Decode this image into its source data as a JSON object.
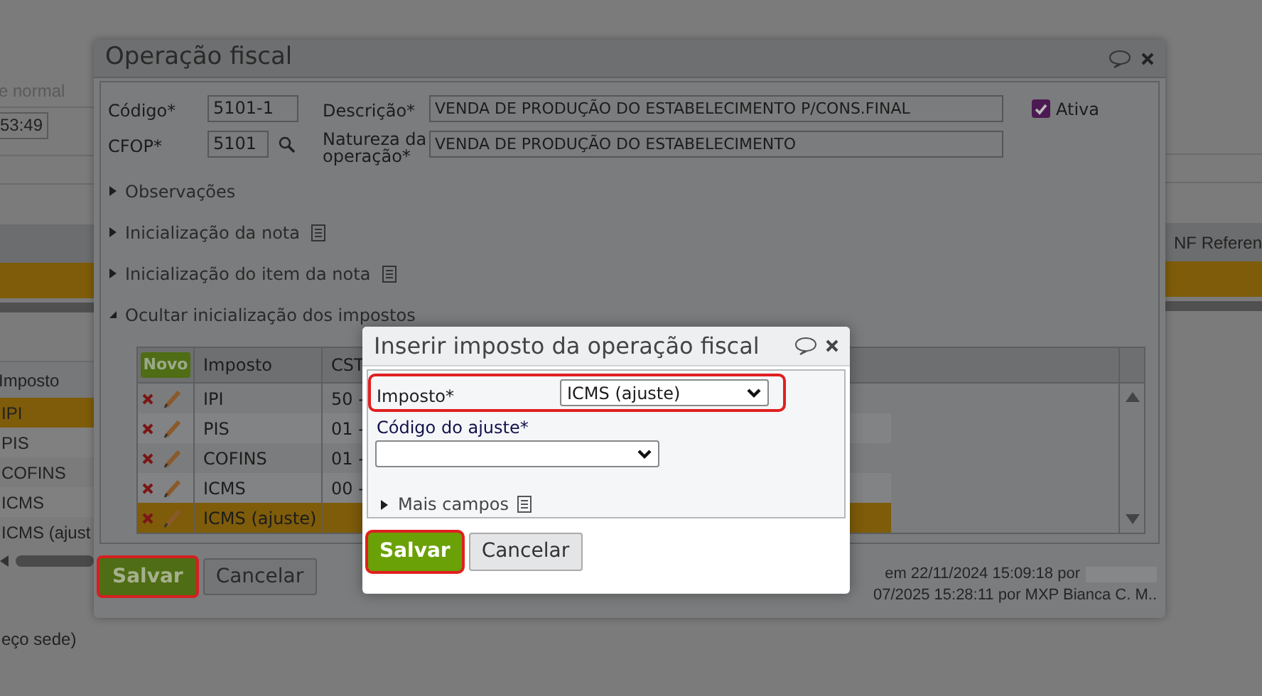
{
  "background": {
    "status_text": "e normal",
    "time_field": "53:49",
    "right_column_header": "NF Referen",
    "left_table": {
      "header": "Imposto",
      "rows": [
        {
          "label": "IPI",
          "selected": true
        },
        {
          "label": "PIS",
          "selected": false
        },
        {
          "label": "COFINS",
          "selected": false
        },
        {
          "label": "ICMS",
          "selected": false
        },
        {
          "label": "ICMS (ajust",
          "selected": false
        }
      ]
    },
    "footer_text": "eço sede)"
  },
  "dialog": {
    "title": "Operação fiscal",
    "codigo_label": "Código*",
    "codigo": "5101-1",
    "cfop_label": "CFOP*",
    "cfop": "5101",
    "descricao_label": "Descrição*",
    "descricao": "VENDA DE PRODUÇÃO DO ESTABELECIMENTO P/CONS.FINAL",
    "natureza_label": "Natureza da operação*",
    "natureza": "VENDA DE PRODUÇÃO DO ESTABELECIMENTO",
    "active_label": "Ativa",
    "active": true,
    "sections": [
      {
        "label": "Observações",
        "expanded": false,
        "has_icon": false
      },
      {
        "label": "Inicialização da nota",
        "expanded": false,
        "has_icon": true
      },
      {
        "label": "Inicialização do item da nota",
        "expanded": false,
        "has_icon": true
      },
      {
        "label": "Ocultar inicialização dos impostos",
        "expanded": true,
        "has_icon": false
      }
    ],
    "tax_table": {
      "new_button": "Novo",
      "columns": [
        "Imposto",
        "CST"
      ],
      "rows": [
        {
          "imposto": "IPI",
          "cst": "50 -",
          "selected": false
        },
        {
          "imposto": "PIS",
          "cst": "01 -",
          "selected": false
        },
        {
          "imposto": "COFINS",
          "cst": "01 -",
          "selected": false
        },
        {
          "imposto": "ICMS",
          "cst": "00 -",
          "selected": false
        },
        {
          "imposto": "ICMS (ajuste)",
          "selected": true
        }
      ]
    },
    "save_button": "Salvar",
    "cancel_button": "Cancelar",
    "audit": [
      "em 22/11/2024 15:09:18 por",
      "07/2025 15:28:11 por MXP Bianca C. M.."
    ]
  },
  "modal": {
    "title": "Inserir imposto da operação fiscal",
    "imposto_label": "Imposto*",
    "imposto_value": "ICMS (ajuste)",
    "codigo_label": "Código do ajuste*",
    "more_fields": "Mais campos",
    "more_expanded": false,
    "save_button": "Salvar",
    "cancel_button": "Cancelar"
  }
}
